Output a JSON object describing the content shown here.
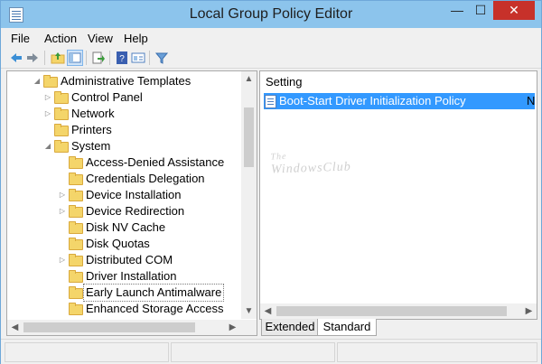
{
  "window": {
    "title": "Local Group Policy Editor",
    "minimize": "—",
    "maximize": "☐",
    "close": "✕"
  },
  "menu": [
    {
      "label": "File"
    },
    {
      "label": "Action"
    },
    {
      "label": "View"
    },
    {
      "label": "Help"
    }
  ],
  "toolbar": {
    "buttons": [
      "back-icon",
      "forward-icon",
      "up-folder-icon",
      "show-hide-tree-icon",
      "export-list-icon",
      "help-icon",
      "properties-icon",
      "filter-icon"
    ]
  },
  "tree": {
    "items": [
      {
        "label": "Administrative Templates",
        "expander": "◢"
      },
      {
        "label": "Control Panel",
        "expander": "▷"
      },
      {
        "label": "Network",
        "expander": "▷"
      },
      {
        "label": "Printers",
        "expander": ""
      },
      {
        "label": "System",
        "expander": "◢"
      },
      {
        "label": "Access-Denied Assistance",
        "expander": ""
      },
      {
        "label": "Credentials Delegation",
        "expander": ""
      },
      {
        "label": "Device Installation",
        "expander": "▷"
      },
      {
        "label": "Device Redirection",
        "expander": "▷"
      },
      {
        "label": "Disk NV Cache",
        "expander": ""
      },
      {
        "label": "Disk Quotas",
        "expander": ""
      },
      {
        "label": "Distributed COM",
        "expander": "▷"
      },
      {
        "label": "Driver Installation",
        "expander": ""
      },
      {
        "label": "Early Launch Antimalware",
        "expander": ""
      },
      {
        "label": "Enhanced Storage Access",
        "expander": ""
      }
    ],
    "scroll_up": "▲",
    "scroll_down": "▼",
    "scroll_left": "◀",
    "scroll_right": "▶"
  },
  "details": {
    "column_header": "Setting",
    "rows": [
      {
        "setting": "Boot-Start Driver Initialization Policy",
        "state_truncated": "N"
      }
    ],
    "scroll_left": "◀",
    "scroll_right": "▶"
  },
  "watermark": {
    "line1": "The",
    "line2": "WindowsClub"
  },
  "tabs": [
    {
      "label": "Extended"
    },
    {
      "label": "Standard",
      "selected": true
    }
  ]
}
